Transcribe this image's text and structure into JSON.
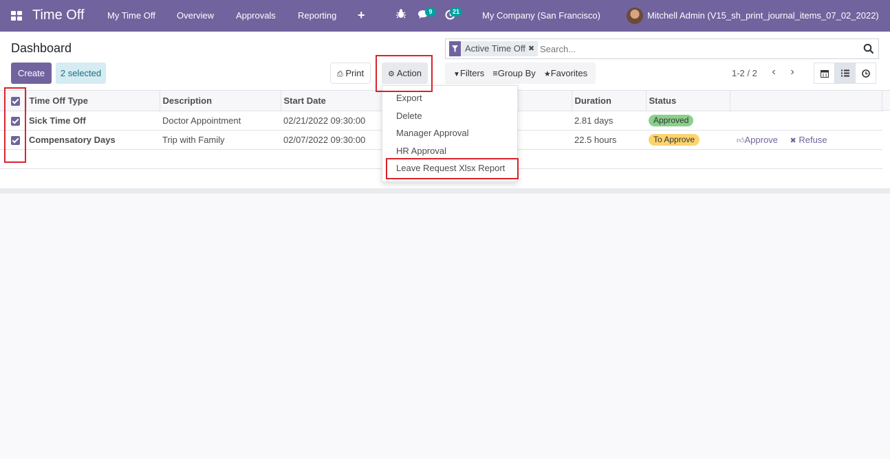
{
  "navbar": {
    "app_title": "Time Off",
    "menu": [
      "My Time Off",
      "Overview",
      "Approvals",
      "Reporting"
    ],
    "messages_count": "9",
    "activities_count": "21",
    "company": "My Company (San Francisco)",
    "user": "Mitchell Admin (V15_sh_print_journal_items_07_02_2022)",
    "accent_color": "#71639e"
  },
  "control_panel": {
    "title": "Dashboard",
    "create_label": "Create",
    "selected_label": "2 selected",
    "print_label": "Print",
    "action_label": "Action"
  },
  "search": {
    "facet_label": "Active Time Off",
    "placeholder": "Search...",
    "filters_label": "Filters",
    "groupby_label": "Group By",
    "favorites_label": "Favorites"
  },
  "pager": {
    "value": "1-2 / 2"
  },
  "views": [
    "calendar-icon",
    "list-icon",
    "activity-icon"
  ],
  "table": {
    "headers": {
      "type": "Time Off Type",
      "description": "Description",
      "start": "Start Date",
      "duration": "Duration",
      "status": "Status"
    },
    "rows": [
      {
        "type": "Sick Time Off",
        "description": "Doctor Appointment",
        "start": "02/21/2022 09:30:00",
        "duration": "2.81 days",
        "status": "Approved",
        "status_color": "#8ad08b"
      },
      {
        "type": "Compensatory Days",
        "description": "Trip with Family",
        "start": "02/07/2022 09:30:00",
        "duration": "22.5 hours",
        "status": "To Approve",
        "status_color": "#fdd36d",
        "approve_label": "Approve",
        "refuse_label": "Refuse"
      }
    ]
  },
  "action_menu": {
    "items": [
      "Export",
      "Delete",
      "Manager Approval",
      "HR Approval",
      "Leave Request Xlsx Report"
    ]
  },
  "highlight_color": "#d9232a"
}
